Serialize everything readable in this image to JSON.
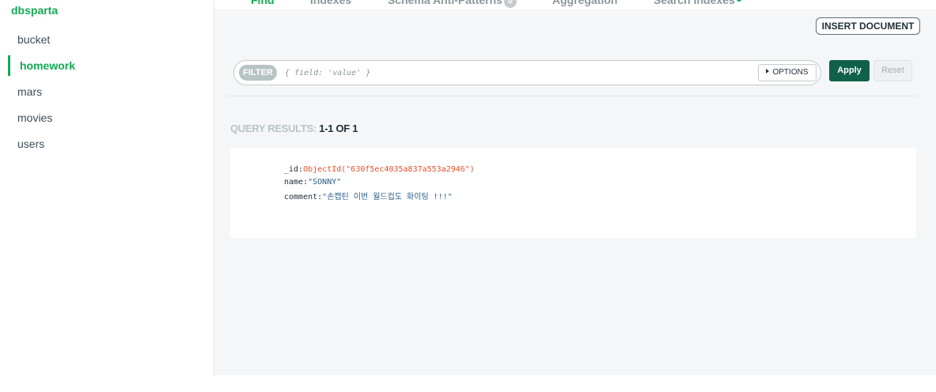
{
  "sidebar": {
    "db_name": "dbsparta",
    "collections": [
      {
        "label": "bucket",
        "active": false
      },
      {
        "label": "homework",
        "active": true
      },
      {
        "label": "mars",
        "active": false
      },
      {
        "label": "movies",
        "active": false
      },
      {
        "label": "users",
        "active": false
      }
    ]
  },
  "tabs": {
    "find": "Find",
    "indexes": "Indexes",
    "schema": "Schema Anti-Patterns",
    "schema_badge": "0",
    "aggregation": "Aggregation",
    "search": "Search Indexes"
  },
  "toolbar": {
    "insert_label": "INSERT DOCUMENT"
  },
  "filter": {
    "label": "FILTER",
    "placeholder": "{ field: 'value' }",
    "value": "",
    "options_label": "OPTIONS",
    "apply_label": "Apply",
    "reset_label": "Reset"
  },
  "results": {
    "label": "QUERY RESULTS:",
    "count": "1-1 OF 1"
  },
  "document": {
    "id_key": "_id:",
    "id_value": "ObjectId(\"630f5ec4035a837a553a2946\")",
    "name_key": "name:",
    "name_value": "\"SONNY\"",
    "comment_key": "comment:",
    "comment_value": "\"손캡틴 이번 월드컵도 화이팅 !!!\""
  },
  "colors": {
    "accent": "#13aa52",
    "apply_bg": "#116149",
    "objectid": "#e8502d",
    "string": "#2d5f8a"
  }
}
